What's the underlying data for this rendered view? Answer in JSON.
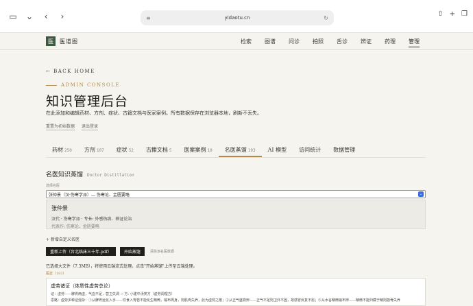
{
  "browser": {
    "url": "yidaotu.cn",
    "left_icons": [
      "sidebar-icon",
      "chevron-down-icon",
      "back-icon",
      "forward-icon"
    ],
    "right_icons": [
      "share-icon",
      "new-tab-icon",
      "tabs-icon"
    ]
  },
  "site": {
    "logo_char": "医",
    "name": "医道图",
    "nav": [
      "检索",
      "图谱",
      "问诊",
      "拍照",
      "舌诊",
      "辨证",
      "药理",
      "管理"
    ],
    "nav_active": "管理"
  },
  "page": {
    "back": "← BACK HOME",
    "eyebrow": "ADMIN CONSOLE",
    "title": "知识管理后台",
    "subtitle": "在此添加和编辑药材、方剂、症状、古籍文档与医家案例。所有数据保存在浏览器本地，刷新不丢失。",
    "links": [
      "重置为初始数据",
      "退出登录"
    ]
  },
  "tabs": [
    {
      "label": "药材",
      "count": "250"
    },
    {
      "label": "方剂",
      "count": "107"
    },
    {
      "label": "症状",
      "count": "52"
    },
    {
      "label": "古籍文档",
      "count": "5"
    },
    {
      "label": "医案案例",
      "count": "10"
    },
    {
      "label": "名医蒸馏",
      "count": "193"
    },
    {
      "label": "AI 模型",
      "count": ""
    },
    {
      "label": "访问统计",
      "count": ""
    },
    {
      "label": "数据管理",
      "count": ""
    }
  ],
  "active_tab": "名医蒸馏",
  "section": {
    "title": "名医知识蒸馏",
    "title_en": "Doctor Distillation",
    "select_label": "选择名医",
    "select_value": "张仲景（汉·伤寒学派）— 伤寒论、金匮要略"
  },
  "doctor_card": {
    "name": "张仲景",
    "line1": "汉代 · 伤寒学派 · 专长: 外感热病、辨证论治",
    "line2": "代表作: 伤寒论、金匮要略"
  },
  "actions": {
    "add_link": "+ 新增自定义名医",
    "reupload": "重新上传（台北临床三十年.pdf）",
    "start": "开始蒸馏",
    "clear": "清除该名医数据"
  },
  "note": "已选择大文件（7.3MB），将使用云端流式处理。点击\"开始蒸馏\"上传至云端处理。",
  "doc_label": "医案（193）",
  "doc": {
    "title": "虚劳诸证（体质性虚劳总论）",
    "line1": "证：虚劳——脾胃两虚，气血不足，营卫失调 → 方: 小建中汤类方（虚劳调理方）",
    "line2": "思路：虚劳多种证混杂：①从脾胃运化入手——饮食入胃若不能化生精微，输布周身，则肌肉失养，此为虚劳之根；②从正气盛衰辨——正气不足则卫外不固，故感冒反复不愈；③从水谷精微输布辨——精微不能归藏于精则筋骨失养"
  }
}
